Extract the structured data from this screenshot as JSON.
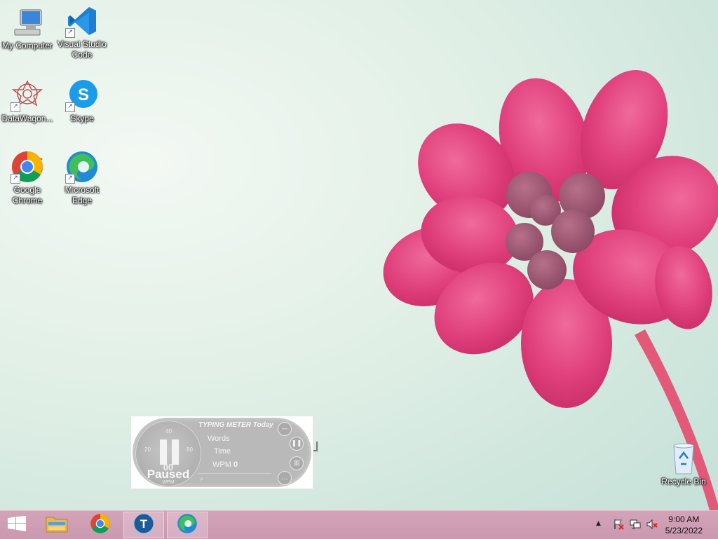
{
  "desktop": {
    "icons": [
      {
        "label": "My Computer",
        "icon": "my-computer-icon"
      },
      {
        "label": "Visual Studio Code",
        "icon": "vscode-icon"
      },
      {
        "label": "DataWagon...",
        "icon": "datawagon-icon"
      },
      {
        "label": "Skype",
        "icon": "skype-icon"
      },
      {
        "label": "Google Chrome",
        "icon": "chrome-icon"
      },
      {
        "label": "Microsoft Edge",
        "icon": "edge-icon"
      },
      {
        "label": "Recycle Bin",
        "icon": "recycle-bin-icon"
      }
    ]
  },
  "typing_meter": {
    "title": "TYPING METER Today",
    "dial_ticks": [
      "20",
      "40",
      "80"
    ],
    "value": "00",
    "status": "Paused",
    "unit": "WPM",
    "words_label": "Words",
    "words_value": "",
    "time_label": "Time",
    "time_value": "",
    "wpm_label": "WPM",
    "wpm_value": "0"
  },
  "taskbar": {
    "apps": [
      {
        "name": "start",
        "icon": "windows-start-icon"
      },
      {
        "name": "file-explorer",
        "icon": "folder-icon"
      },
      {
        "name": "chrome",
        "icon": "chrome-icon"
      },
      {
        "name": "typing-meter",
        "icon": "typing-meter-icon",
        "active": true
      },
      {
        "name": "edge",
        "icon": "edge-icon",
        "active": true
      }
    ],
    "tray": {
      "time": "9:00 AM",
      "date": "5/23/2022"
    }
  },
  "colors": {
    "taskbar": "#cf9fb4",
    "flower": "#e8407a",
    "widget": "#b9b9b9"
  }
}
